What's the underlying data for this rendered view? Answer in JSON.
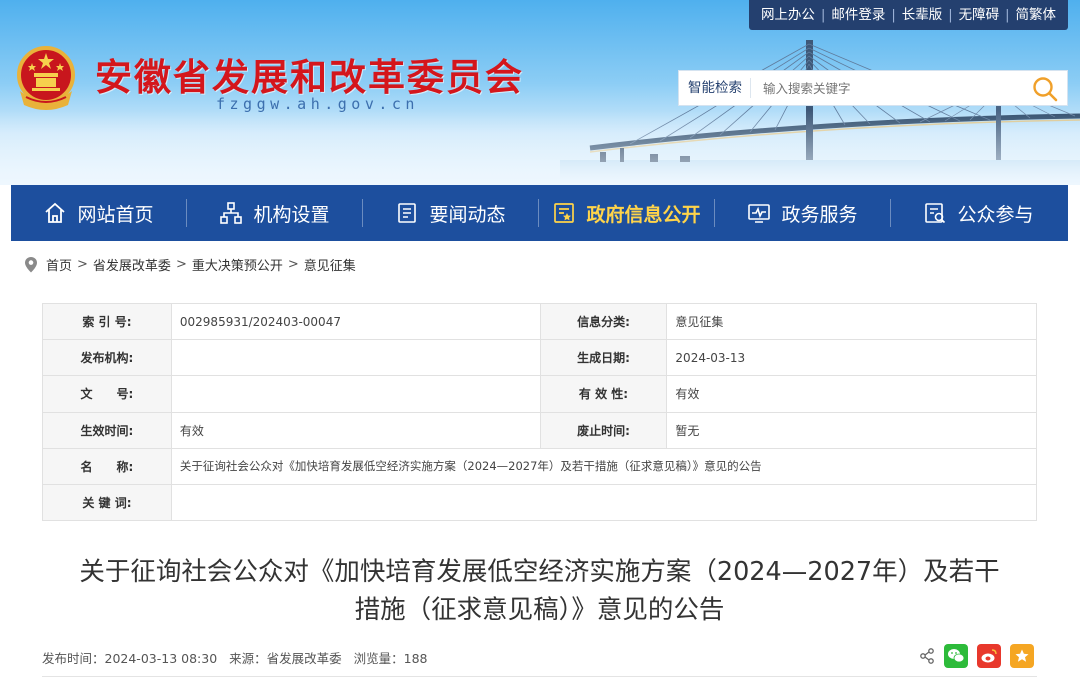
{
  "header": {
    "site_title": "安徽省发展和改革委员会",
    "site_domain": "fzggw.ah.gov.cn",
    "top_links": [
      "网上办公",
      "邮件登录",
      "长辈版",
      "无障碍",
      "简繁体"
    ],
    "search": {
      "label": "智能检索",
      "placeholder": "输入搜索关键字"
    }
  },
  "nav": {
    "items": [
      {
        "label": "网站首页",
        "icon": "home-icon"
      },
      {
        "label": "机构设置",
        "icon": "org-chart-icon"
      },
      {
        "label": "要闻动态",
        "icon": "news-icon"
      },
      {
        "label": "政府信息公开",
        "icon": "gov-info-icon",
        "active": true
      },
      {
        "label": "政务服务",
        "icon": "monitor-icon"
      },
      {
        "label": "公众参与",
        "icon": "participation-icon"
      }
    ]
  },
  "breadcrumb": [
    "首页",
    "省发展改革委",
    "重大决策预公开",
    "意见征集"
  ],
  "info_table": {
    "index_no_label": "索 引 号:",
    "index_no": "002985931/202403-00047",
    "category_label": "信息分类:",
    "category": "意见征集",
    "publisher_label": "发布机构:",
    "publisher": "",
    "gen_date_label": "生成日期:",
    "gen_date": "2024-03-13",
    "doc_no_label": "文　　号:",
    "doc_no": "",
    "validity_label": "有 效 性:",
    "validity": "有效",
    "effective_label": "生效时间:",
    "effective": "有效",
    "repeal_label": "废止时间:",
    "repeal": "暂无",
    "name_label": "名　　称:",
    "name": "关于征询社会公众对《加快培育发展低空经济实施方案（2024—2027年）及若干措施（征求意见稿）》意见的公告",
    "keywords_label": "关 键 词:",
    "keywords": ""
  },
  "article": {
    "title_line1": "关于征询社会公众对《加快培育发展低空经济实施方案（2024—2027年）及若干",
    "title_line2": "措施（征求意见稿）》意见的公告",
    "publish_time": "发布时间：2024-03-13 08:30",
    "source": "来源：省发展改革委",
    "views": "浏览量：188"
  },
  "colors": {
    "nav_bg": "#1d4f9e",
    "nav_active": "#ffd44a",
    "title_red": "#d4161c",
    "toplinks_bg": "#24406f"
  }
}
